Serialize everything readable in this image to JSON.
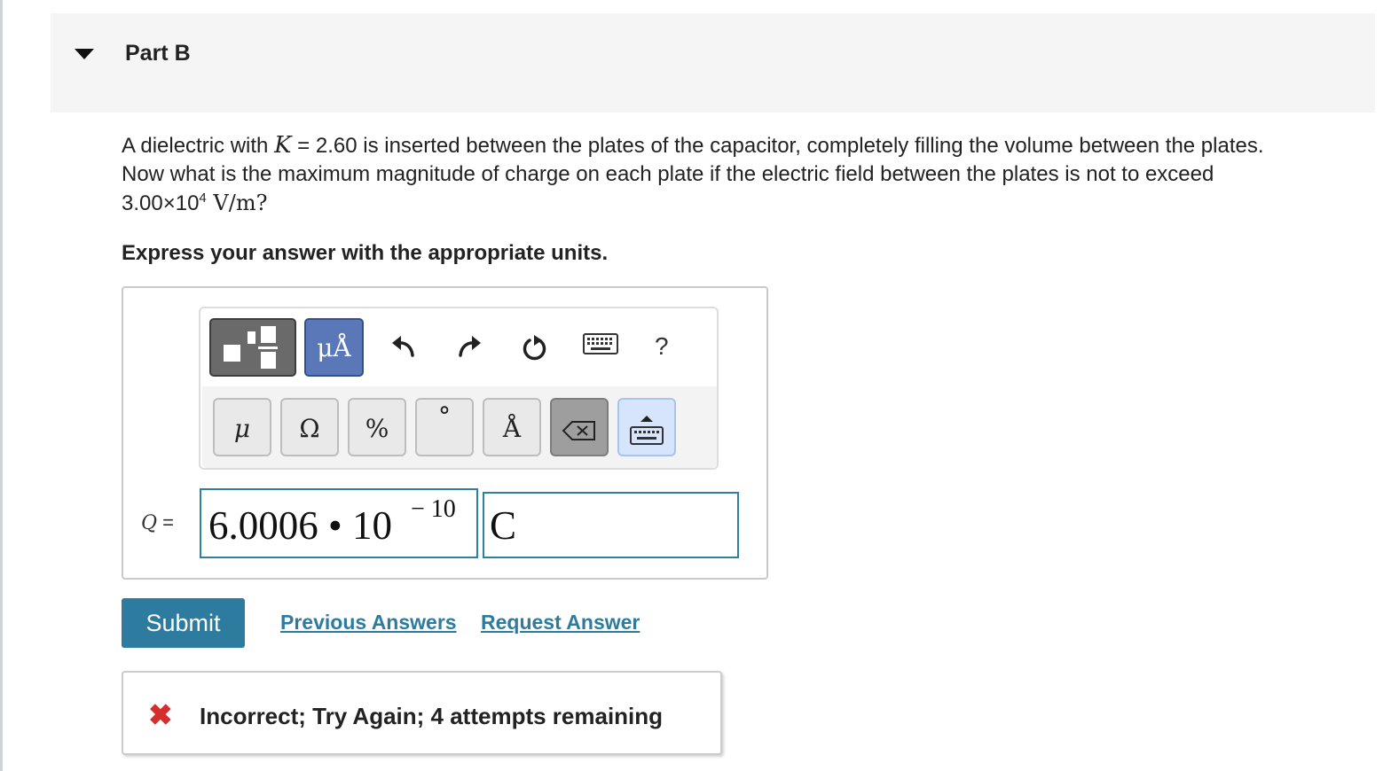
{
  "part": {
    "title": "Part B"
  },
  "question": {
    "line1_pre": "A dielectric with ",
    "symbol_K": "K",
    "line1_post": " = 2.60 is inserted between the plates of the capacitor, completely filling the volume between the plates.",
    "line2": "Now what is the maximum magnitude of charge on each plate if the electric field between the plates is not to exceed",
    "line3_base": "3.00×10",
    "line3_exp": "4",
    "line3_unit": " V/m?"
  },
  "instruction": "Express your answer with the appropriate units.",
  "toolbar": {
    "units_label": "μÅ",
    "help_label": "?",
    "icons": [
      "templates-icon",
      "units-icon",
      "undo-icon",
      "redo-icon",
      "reset-icon",
      "keyboard-icon",
      "help-icon"
    ]
  },
  "keypad": {
    "mu": "μ",
    "omega": "Ω",
    "percent": "%",
    "degree": "°",
    "angstrom": "Å"
  },
  "answer": {
    "variable": "Q",
    "equals": " =",
    "value_main": "6.0006 • 10",
    "value_exponent": "− 10",
    "unit": "C"
  },
  "actions": {
    "submit": "Submit",
    "previous_answers": "Previous Answers",
    "request_answer": "Request Answer"
  },
  "feedback": {
    "icon": "✖",
    "text": "Incorrect; Try Again; 4 attempts remaining",
    "color": "#d62d2d"
  },
  "colors": {
    "accent": "#2e7ba0",
    "units_button": "#5a77b8"
  }
}
